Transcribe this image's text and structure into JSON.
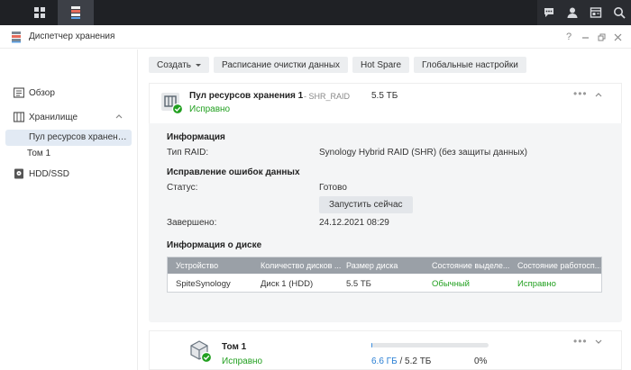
{
  "taskbar": {
    "left_icons": [
      "grid-apps-icon",
      "storage-manager-icon"
    ],
    "right_icons": [
      "chat-icon",
      "user-icon",
      "widgets-icon",
      "search-icon"
    ]
  },
  "window": {
    "title": "Диспетчер хранения",
    "controls": [
      "help-icon",
      "minimize-icon",
      "restore-icon",
      "close-icon"
    ]
  },
  "sidebar": {
    "items": [
      {
        "label": "Обзор",
        "icon": "overview-icon"
      },
      {
        "label": "Хранилище",
        "icon": "storage-icon"
      },
      {
        "label": "Пул ресурсов хранения 1",
        "selected": true
      },
      {
        "label": "Том 1"
      },
      {
        "label": "HDD/SSD",
        "icon": "hdd-icon"
      }
    ]
  },
  "toolbar": {
    "create_label": "Создать",
    "schedule_label": "Расписание очистки данных",
    "hotspare_label": "Hot Spare",
    "global_label": "Глобальные настройки"
  },
  "pool": {
    "name": "Пул ресурсов хранения 1",
    "raid_tag": "- SHR_RAID",
    "size": "5.5 ТБ",
    "status": "Исправно",
    "info_title": "Информация",
    "raid_type_label": "Тип RAID:",
    "raid_type_value": "Synology Hybrid RAID (SHR) (без защиты данных)",
    "scrub_title": "Исправление ошибок данных",
    "scrub_status_label": "Статус:",
    "scrub_status_value": "Готово",
    "run_now_label": "Запустить сейчас",
    "completed_label": "Завершено:",
    "completed_value": "24.12.2021 08:29",
    "disk_info_title": "Информация о диске",
    "disk_table": {
      "headers": [
        "Устройство",
        "Количество дисков ...",
        "Размер диска",
        "Состояние выделе...",
        "Состояние работосп..."
      ],
      "rows": [
        [
          "SpiteSynology",
          "Диск 1 (HDD)",
          "5.5 ТБ",
          "Обычный",
          "Исправно"
        ]
      ]
    }
  },
  "volume": {
    "name": "Том 1",
    "status": "Исправно",
    "used": "6.6 ГБ",
    "separator": " / ",
    "total": "5.2 ТБ",
    "percent_text": "0%",
    "usage_fraction": 0.0012
  },
  "colors": {
    "status_green": "#22a020",
    "accent_blue": "#2a7fd4",
    "table_header": "#9aa0a7"
  }
}
